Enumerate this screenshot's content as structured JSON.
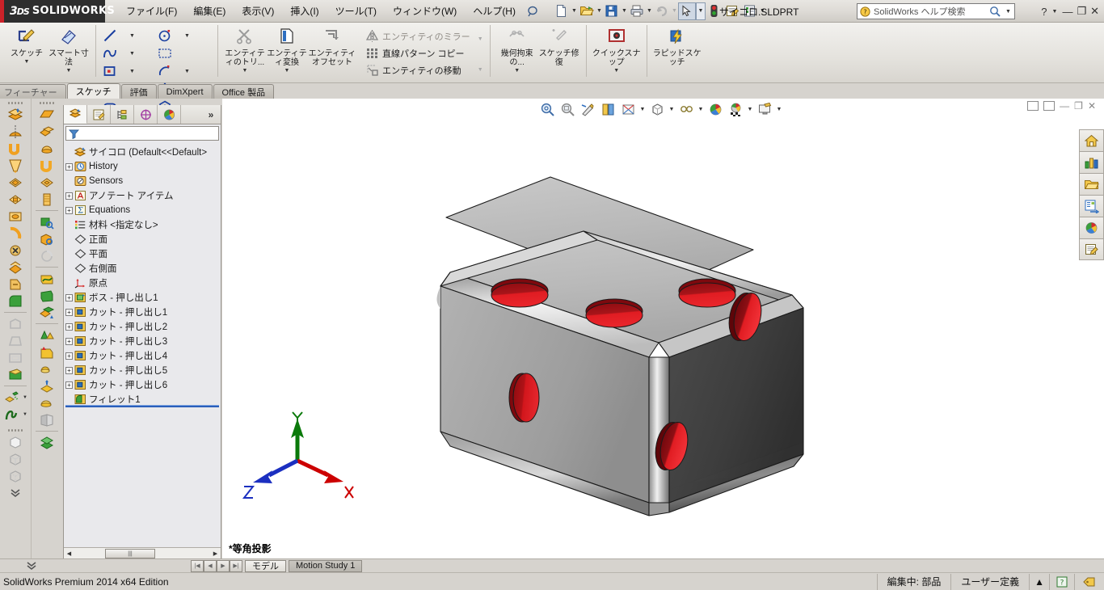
{
  "app": {
    "brand_ds": "3DS",
    "brand_name": "SOLIDWORKS",
    "document_title": "サイコロ.SLDPRT",
    "status_text": "SolidWorks Premium 2014 x64 Edition",
    "accent_red": "#cc2229",
    "accent_blue": "#2b5fbb"
  },
  "menu": {
    "items": [
      {
        "label": "ファイル(F)"
      },
      {
        "label": "編集(E)"
      },
      {
        "label": "表示(V)"
      },
      {
        "label": "挿入(I)"
      },
      {
        "label": "ツール(T)"
      },
      {
        "label": "ウィンドウ(W)"
      },
      {
        "label": "ヘルプ(H)"
      }
    ]
  },
  "quick_toolbar": {
    "items": [
      {
        "name": "new-document-icon",
        "has_dropdown": true
      },
      {
        "name": "open-document-icon",
        "has_dropdown": true
      },
      {
        "name": "save-icon",
        "has_dropdown": true
      },
      {
        "name": "print-icon",
        "has_dropdown": true
      },
      {
        "name": "undo-icon",
        "has_dropdown": true,
        "disabled": true
      },
      {
        "name": "select-arrow-icon",
        "has_dropdown": true,
        "pressed": true
      },
      {
        "name": "rebuild-icon",
        "has_dropdown": false
      },
      {
        "name": "options-icon",
        "has_dropdown": false
      },
      {
        "name": "custom-properties-icon",
        "has_dropdown": true
      }
    ]
  },
  "help_search": {
    "placeholder": "SolidWorks ヘルプ検索",
    "icon": "help-question-icon",
    "magnifier": "magnifier-icon"
  },
  "window_controls": {
    "help": "?",
    "minimize": "—",
    "restore": "❐",
    "close": "✕"
  },
  "ribbon": {
    "groups": [
      {
        "type": "big",
        "buttons": [
          {
            "label": "スケッチ",
            "icon": "sketch-pencil-icon",
            "dropdown": true
          },
          {
            "label": "スマート寸法",
            "icon": "smart-dimension-icon",
            "dropdown": true
          }
        ]
      },
      {
        "type": "grid",
        "cells": [
          {
            "icon": "line-icon",
            "dropdown": true
          },
          {
            "icon": "circle-icon",
            "dropdown": true
          },
          {
            "icon": "spline-icon",
            "dropdown": true
          },
          {
            "icon": "trim-box-icon",
            "dropdown": false
          },
          {
            "icon": "rectangle-icon",
            "dropdown": true
          },
          {
            "icon": "arc-icon",
            "dropdown": true
          },
          {
            "icon": "ellipse-icon",
            "dropdown": true
          },
          {
            "icon": "text-a-icon",
            "dropdown": false
          },
          {
            "icon": "slot-icon",
            "dropdown": true
          },
          {
            "icon": "polygon-icon",
            "dropdown": true
          },
          {
            "icon": "fillet-corner-icon",
            "dropdown": true,
            "disabled": true
          },
          {
            "icon": "point-star-icon",
            "dropdown": false
          }
        ]
      },
      {
        "type": "big",
        "buttons": [
          {
            "label": "エンティティのトリ...",
            "icon": "trim-entities-icon",
            "dropdown": true
          },
          {
            "label": "エンティティ変換",
            "icon": "convert-entities-icon",
            "dropdown": true
          },
          {
            "label": "エンティティオフセット",
            "icon": "offset-entities-icon",
            "dropdown": false
          }
        ]
      },
      {
        "type": "rows",
        "rows": [
          {
            "label": "エンティティのミラー",
            "icon": "mirror-entities-icon",
            "dropdown": true
          },
          {
            "label": "直線パターン コピー",
            "icon": "linear-pattern-icon",
            "dropdown": true
          },
          {
            "label": "エンティティの移動",
            "icon": "move-entities-icon",
            "dropdown": true
          }
        ]
      },
      {
        "type": "big",
        "buttons": [
          {
            "label": "幾何拘束の...",
            "icon": "geometric-relations-icon",
            "dropdown": true,
            "disabled": true
          },
          {
            "label": "スケッチ修復",
            "icon": "repair-sketch-icon",
            "dropdown": false,
            "disabled": true
          }
        ]
      },
      {
        "type": "big",
        "buttons": [
          {
            "label": "クイックスナップ",
            "icon": "quick-snaps-icon",
            "dropdown": true
          }
        ]
      },
      {
        "type": "big",
        "buttons": [
          {
            "label": "ラピッドスケッチ",
            "icon": "rapid-sketch-icon",
            "dropdown": false
          }
        ]
      }
    ]
  },
  "command_tabs": {
    "items": [
      {
        "label": "フィーチャー",
        "active": false
      },
      {
        "label": "スケッチ",
        "active": true
      },
      {
        "label": "評価",
        "active": false
      },
      {
        "label": "DimXpert",
        "active": false
      },
      {
        "label": "Office 製品",
        "active": false
      }
    ]
  },
  "feature_manager": {
    "tabs": [
      {
        "name": "feature-manager-tree-tab",
        "active": true
      },
      {
        "name": "property-manager-tab",
        "active": false
      },
      {
        "name": "configuration-manager-tab",
        "active": false
      },
      {
        "name": "dimxpert-manager-tab",
        "active": false
      },
      {
        "name": "display-manager-tab",
        "active": false
      }
    ],
    "more_label": "»",
    "filter_placeholder": "",
    "root": "サイコロ  (Default<<Default>",
    "tree": [
      {
        "label": "History",
        "icon": "history-icon",
        "expandable": true,
        "indent": 1
      },
      {
        "label": "Sensors",
        "icon": "sensors-icon",
        "expandable": false,
        "indent": 1
      },
      {
        "label": "アノテート アイテム",
        "icon": "annotations-icon",
        "expandable": true,
        "indent": 1
      },
      {
        "label": "Equations",
        "icon": "equations-icon",
        "expandable": true,
        "indent": 1
      },
      {
        "label": "材料 <指定なし>",
        "icon": "material-icon",
        "expandable": false,
        "indent": 1
      },
      {
        "label": "正面",
        "icon": "plane-icon",
        "expandable": false,
        "indent": 1
      },
      {
        "label": "平面",
        "icon": "plane-icon",
        "expandable": false,
        "indent": 1
      },
      {
        "label": "右側面",
        "icon": "plane-icon",
        "expandable": false,
        "indent": 1
      },
      {
        "label": "原点",
        "icon": "origin-icon",
        "expandable": false,
        "indent": 1
      },
      {
        "label": "ボス - 押し出し1",
        "icon": "boss-extrude-icon",
        "expandable": true,
        "indent": 1
      },
      {
        "label": "カット - 押し出し1",
        "icon": "cut-extrude-icon",
        "expandable": true,
        "indent": 1
      },
      {
        "label": "カット - 押し出し2",
        "icon": "cut-extrude-icon",
        "expandable": true,
        "indent": 1
      },
      {
        "label": "カット - 押し出し3",
        "icon": "cut-extrude-icon",
        "expandable": true,
        "indent": 1
      },
      {
        "label": "カット - 押し出し4",
        "icon": "cut-extrude-icon",
        "expandable": true,
        "indent": 1
      },
      {
        "label": "カット - 押し出し5",
        "icon": "cut-extrude-icon",
        "expandable": true,
        "indent": 1
      },
      {
        "label": "カット - 押し出し6",
        "icon": "cut-extrude-icon",
        "expandable": true,
        "indent": 1
      },
      {
        "label": "フィレット1",
        "icon": "fillet-icon",
        "expandable": false,
        "indent": 1
      }
    ]
  },
  "view_toolbar": {
    "items": [
      {
        "name": "zoom-to-fit-icon",
        "dropdown": false
      },
      {
        "name": "zoom-to-area-icon",
        "dropdown": false
      },
      {
        "name": "previous-view-icon",
        "dropdown": false
      },
      {
        "name": "section-view-icon",
        "dropdown": false
      },
      {
        "name": "view-orientation-icon",
        "dropdown": true
      },
      {
        "name": "display-style-icon",
        "dropdown": true
      },
      {
        "name": "hide-show-items-icon",
        "dropdown": true
      },
      {
        "name": "edit-appearance-icon",
        "dropdown": false
      },
      {
        "name": "apply-scene-icon",
        "dropdown": true
      },
      {
        "name": "view-settings-icon",
        "dropdown": true
      }
    ]
  },
  "graphics": {
    "view_label": "*等角投影",
    "triad": {
      "x_label": "X",
      "y_label": "Y",
      "z_label": "Z",
      "x_color": "#cc0000",
      "y_color": "#0b7a0b",
      "z_color": "#1b2fc0"
    },
    "model": {
      "name": "dice",
      "top_face_pips": 3,
      "left_face_pips": 1,
      "right_face_pips": 2,
      "body_color": "#b8b8b8",
      "pip_color": "#d81217",
      "pip_shadow_color": "#8e0b10"
    }
  },
  "task_pane": {
    "buttons": [
      {
        "name": "solidworks-resources-icon"
      },
      {
        "name": "design-library-icon"
      },
      {
        "name": "file-explorer-icon"
      },
      {
        "name": "view-palette-icon"
      },
      {
        "name": "appearances-scenes-icon"
      },
      {
        "name": "custom-properties-icon"
      }
    ]
  },
  "left_toolbars": {
    "column_a": [
      {
        "name": "extruded-boss-base-icon"
      },
      {
        "name": "revolved-boss-base-icon"
      },
      {
        "name": "swept-boss-base-icon"
      },
      {
        "name": "lofted-boss-base-icon"
      },
      {
        "name": "boundary-boss-base-icon"
      },
      {
        "name": "extruded-cut-icon"
      },
      {
        "name": "hole-wizard-icon"
      },
      {
        "name": "revolved-cut-icon"
      },
      {
        "name": "swept-cut-icon"
      },
      {
        "name": "lofted-cut-icon"
      },
      {
        "name": "boundary-cut-icon"
      },
      {
        "name": "fillet-icon"
      },
      {
        "name": "chamfer-icon"
      },
      {
        "name": "draft-icon"
      },
      {
        "name": "shell-icon"
      },
      {
        "name": "rib-icon"
      },
      {
        "name": "linear-pattern-icon"
      },
      {
        "name": "curve-icon"
      }
    ],
    "column_b": [
      {
        "name": "reference-plane-icon"
      },
      {
        "name": "mirror-icon"
      },
      {
        "name": "dome-icon"
      },
      {
        "name": "wrap-icon"
      },
      {
        "name": "flex-icon"
      },
      {
        "name": "indent-icon"
      },
      {
        "name": "measure-icon"
      },
      {
        "name": "section-properties-icon"
      },
      {
        "name": "deviation-analysis-icon"
      },
      {
        "name": "curvature-icon"
      },
      {
        "name": "zebra-stripes-icon"
      },
      {
        "name": "draft-analysis-icon"
      },
      {
        "name": "simulation-icon"
      },
      {
        "name": "molds-icon"
      },
      {
        "name": "combine-icon"
      },
      {
        "name": "split-icon"
      },
      {
        "name": "move-copy-bodies-icon"
      },
      {
        "name": "delete-body-icon"
      }
    ],
    "column_c": [
      {
        "name": "shaded-box-icon"
      },
      {
        "name": "wireframe-box-icon"
      },
      {
        "name": "hidden-lines-box-icon"
      },
      {
        "name": "expand-chevrons-icon"
      }
    ]
  },
  "model_tabs": {
    "collapse_icon": "chevron-double-down-icon",
    "nav_buttons": [
      "first",
      "prev",
      "next",
      "last"
    ],
    "tabs": [
      {
        "label": "モデル",
        "active": false
      },
      {
        "label": "Motion Study 1",
        "active": true
      }
    ]
  },
  "statusbar": {
    "left": "SolidWorks Premium 2014 x64 Edition",
    "editing": "編集中:  部品",
    "units": "ユーザー定義",
    "units_caret": "▲",
    "help_badge": "?",
    "tag_icon": "tag-icon"
  }
}
